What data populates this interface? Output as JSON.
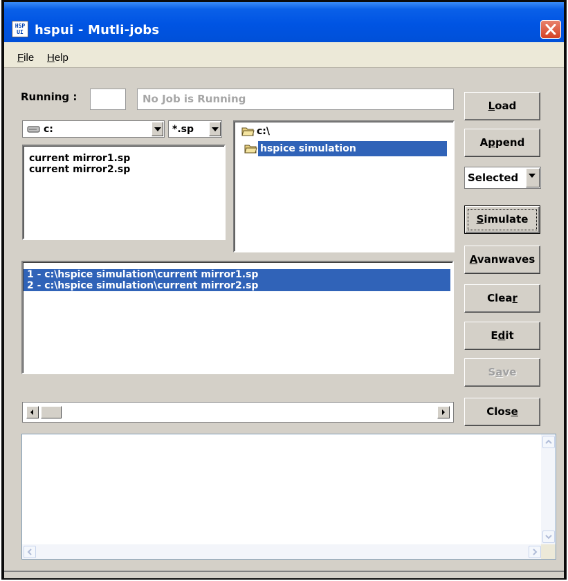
{
  "window": {
    "title": "hspui - Mutli-jobs",
    "app_icon_line1": "HSP",
    "app_icon_line2": "UI"
  },
  "menu": {
    "items": [
      {
        "label": "File",
        "mnemonic": "F",
        "rest": "ile"
      },
      {
        "label": "Help",
        "mnemonic": "H",
        "rest": "elp"
      }
    ]
  },
  "status": {
    "running_label": "Running :",
    "running_count": "",
    "job_status": "No Job is Running"
  },
  "drive_select": {
    "value": "c:",
    "icon": "drive-icon"
  },
  "filter_select": {
    "value": "*.sp"
  },
  "file_list": [
    "current mirror1.sp",
    "current mirror2.sp"
  ],
  "folder_tree": [
    {
      "label": "c:\\",
      "icon": "open-folder-icon",
      "selected": false
    },
    {
      "label": "hspice simulation",
      "icon": "open-folder-icon",
      "selected": true
    }
  ],
  "job_list": [
    "1 - c:\\hspice simulation\\current mirror1.sp",
    "2 - c:\\hspice simulation\\current mirror2.sp"
  ],
  "buttons": {
    "load": {
      "pre": "",
      "mnemonic": "L",
      "post": "oad"
    },
    "append": {
      "pre": "A",
      "mnemonic": "p",
      "post": "pend"
    },
    "mode_select": "Selected",
    "simulate": {
      "pre": "",
      "mnemonic": "S",
      "post": "imulate"
    },
    "avanwaves": {
      "pre": "",
      "mnemonic": "A",
      "post": "vanwaves"
    },
    "clear": {
      "pre": "Clea",
      "mnemonic": "r",
      "post": ""
    },
    "edit": {
      "pre": "E",
      "mnemonic": "d",
      "post": "it"
    },
    "save": {
      "pre": "S",
      "mnemonic": "a",
      "post": "ve"
    },
    "close": {
      "pre": "Clos",
      "mnemonic": "e",
      "post": ""
    }
  },
  "output_text": "",
  "colors": {
    "title_bar": "#0054E3",
    "selection": "#3063B8",
    "face": "#D4D0C8",
    "close_button": "#D44125"
  }
}
